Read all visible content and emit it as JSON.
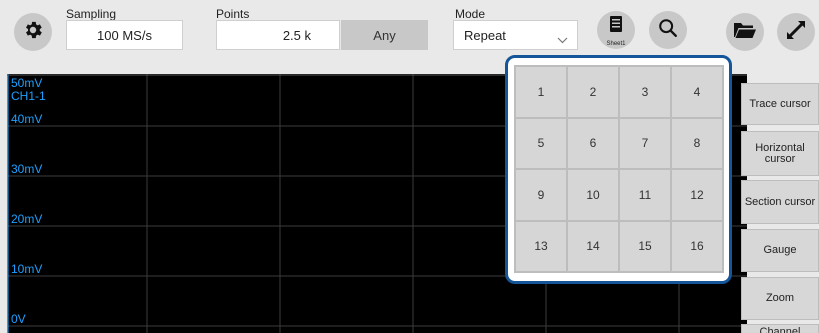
{
  "toolbar": {
    "sampling": {
      "label": "Sampling",
      "value": "100 MS/s"
    },
    "points": {
      "label": "Points",
      "value": "2.5 k",
      "any_label": "Any"
    },
    "mode": {
      "label": "Mode",
      "value": "Repeat"
    },
    "sheet_label": "Sheet1",
    "icons": [
      "gear-icon",
      "sheet-icon",
      "search-icon",
      "folder-icon",
      "expand-icon"
    ]
  },
  "scope": {
    "channel": "CH1-1",
    "y_labels": [
      "50mV",
      "40mV",
      "30mV",
      "20mV",
      "10mV",
      "0V"
    ],
    "trace_color": "#1ea0ff"
  },
  "side_buttons": [
    "Trace cursor",
    "Horizontal cursor",
    "Section cursor",
    "Gauge",
    "Zoom",
    "Channel"
  ],
  "popup": {
    "cells": [
      "1",
      "2",
      "3",
      "4",
      "5",
      "6",
      "7",
      "8",
      "9",
      "10",
      "11",
      "12",
      "13",
      "14",
      "15",
      "16"
    ]
  }
}
